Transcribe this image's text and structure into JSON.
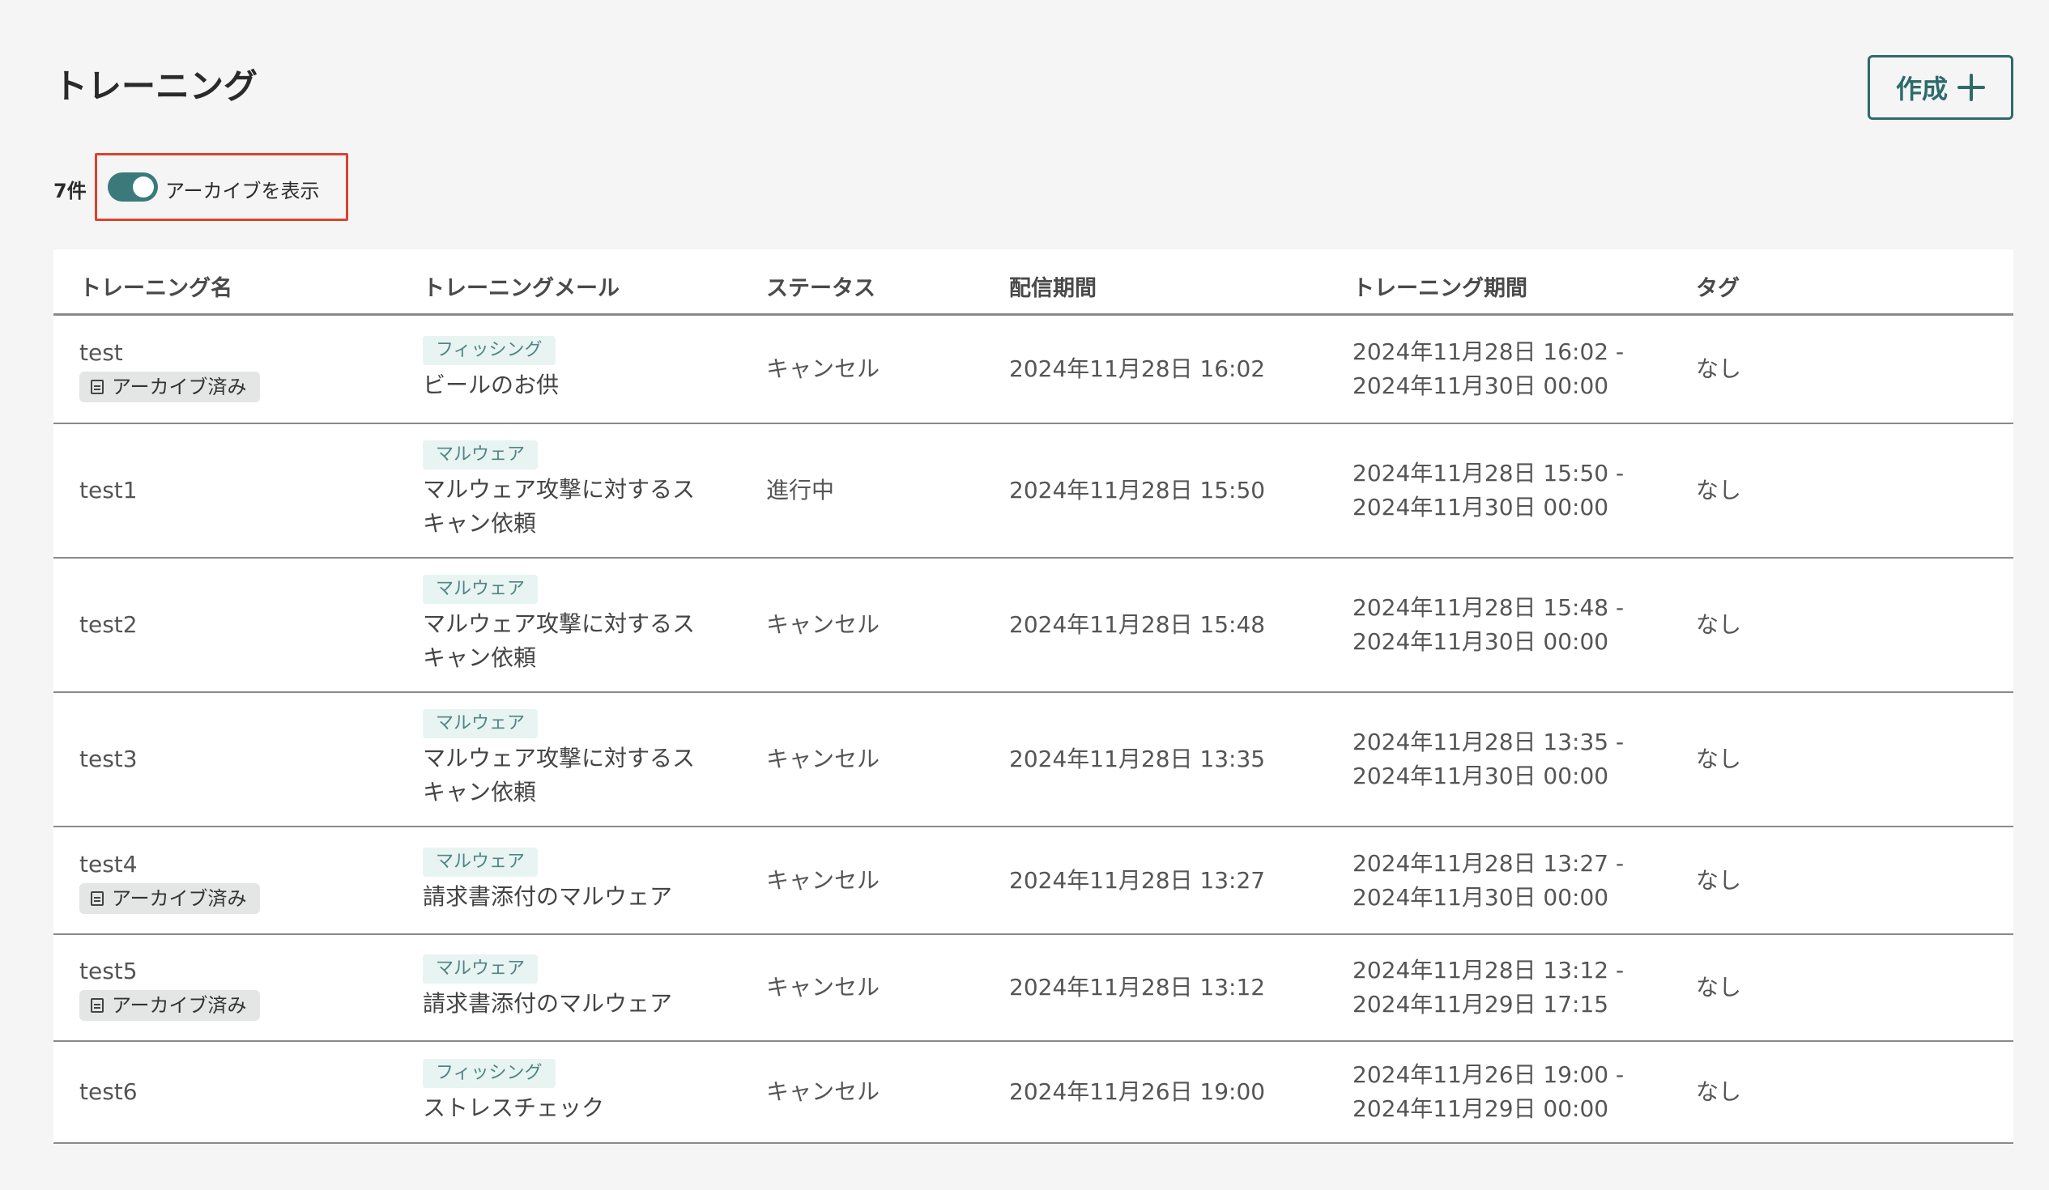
{
  "header": {
    "title": "トレーニング",
    "create_label": "作成"
  },
  "filter": {
    "count": "7件",
    "archive_toggle_label": "アーカイブを表示",
    "archive_toggle_on": true
  },
  "colors": {
    "accent": "#2e6b6b",
    "highlight": "#d9432f"
  },
  "table": {
    "headers": {
      "name": "トレーニング名",
      "mail": "トレーニングメール",
      "status": "ステータス",
      "delivery": "配信期間",
      "period": "トレーニング期間",
      "tag": "タグ"
    },
    "rows": [
      {
        "name": "test",
        "archived": "アーカイブ済み",
        "mail_type": "フィッシング",
        "mail_title": "ビールのお供",
        "status": "キャンセル",
        "delivery": "2024年11月28日 16:02",
        "period_start": "2024年11月28日 16:02 -",
        "period_end": "2024年11月30日 00:00",
        "tag": "なし"
      },
      {
        "name": "test1",
        "archived": null,
        "mail_type": "マルウェア",
        "mail_title": "マルウェア攻撃に対するス",
        "mail_title_2": "キャン依頼",
        "status": "進行中",
        "delivery": "2024年11月28日 15:50",
        "period_start": "2024年11月28日 15:50 -",
        "period_end": "2024年11月30日 00:00",
        "tag": "なし"
      },
      {
        "name": "test2",
        "archived": null,
        "mail_type": "マルウェア",
        "mail_title": "マルウェア攻撃に対するス",
        "mail_title_2": "キャン依頼",
        "status": "キャンセル",
        "delivery": "2024年11月28日 15:48",
        "period_start": "2024年11月28日 15:48 -",
        "period_end": "2024年11月30日 00:00",
        "tag": "なし"
      },
      {
        "name": "test3",
        "archived": null,
        "mail_type": "マルウェア",
        "mail_title": "マルウェア攻撃に対するス",
        "mail_title_2": "キャン依頼",
        "status": "キャンセル",
        "delivery": "2024年11月28日 13:35",
        "period_start": "2024年11月28日 13:35 -",
        "period_end": "2024年11月30日 00:00",
        "tag": "なし"
      },
      {
        "name": "test4",
        "archived": "アーカイブ済み",
        "mail_type": "マルウェア",
        "mail_title": "請求書添付のマルウェア",
        "status": "キャンセル",
        "delivery": "2024年11月28日 13:27",
        "period_start": "2024年11月28日 13:27 -",
        "period_end": "2024年11月30日 00:00",
        "tag": "なし"
      },
      {
        "name": "test5",
        "archived": "アーカイブ済み",
        "mail_type": "マルウェア",
        "mail_title": "請求書添付のマルウェア",
        "status": "キャンセル",
        "delivery": "2024年11月28日 13:12",
        "period_start": "2024年11月28日 13:12 -",
        "period_end": "2024年11月29日 17:15",
        "tag": "なし"
      },
      {
        "name": "test6",
        "archived": null,
        "mail_type": "フィッシング",
        "mail_title": "ストレスチェック",
        "status": "キャンセル",
        "delivery": "2024年11月26日 19:00",
        "period_start": "2024年11月26日 19:00 -",
        "period_end": "2024年11月29日 00:00",
        "tag": "なし"
      }
    ]
  }
}
